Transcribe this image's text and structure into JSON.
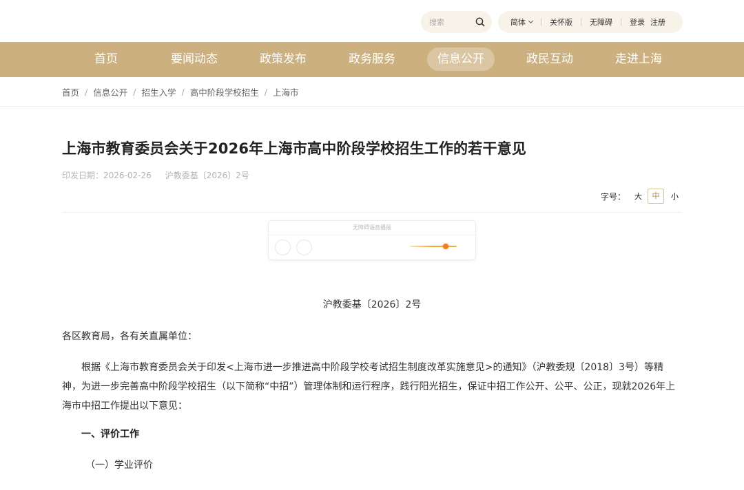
{
  "search": {
    "placeholder": "搜索"
  },
  "utility": {
    "language": "简体",
    "care_mode": "关怀版",
    "accessibility": "无障碍",
    "login": "登录",
    "register": "注册"
  },
  "nav": {
    "items": [
      {
        "label": "首页"
      },
      {
        "label": "要闻动态"
      },
      {
        "label": "政策发布"
      },
      {
        "label": "政务服务"
      },
      {
        "label": "信息公开"
      },
      {
        "label": "政民互动"
      },
      {
        "label": "走进上海"
      }
    ],
    "active": "信息公开"
  },
  "breadcrumb": [
    "首页",
    "信息公开",
    "招生入学",
    "高中阶段学校招生",
    "上海市"
  ],
  "breadcrumb_sep": "/",
  "article": {
    "title": "上海市教育委员会关于2026年上海市高中阶段学校招生工作的若干意见",
    "date_label": "印发日期：2026-02-26",
    "doc_ref": "沪教委基〔2026〕2号"
  },
  "font_size": {
    "label": "字号：",
    "large": "大",
    "medium": "中",
    "small": "小",
    "selected": "中"
  },
  "player": {
    "label": "无障碍语音播报"
  },
  "body": {
    "doc_number": "沪教委基〔2026〕2号",
    "salutation": "各区教育局，各有关直属单位：",
    "paragraph1": "根据《上海市教育委员会关于印发<上海市进一步推进高中阶段学校考试招生制度改革实施意见>的通知》（沪教委规〔2018〕3号）等精神，为进一步完善高中阶段学校招生（以下简称“中招”）管理体制和运行程序，践行阳光招生，保证中招工作公开、公平、公正，现就2026年上海市中招工作提出以下意见：",
    "section1": "一、评价工作",
    "subsection1": "（一）学业评价"
  },
  "colors": {
    "nav_bg": "#ccb07f",
    "util_bg": "#f8f3e9",
    "accent": "#b08d4f",
    "player_knob": "#f07d1a"
  }
}
